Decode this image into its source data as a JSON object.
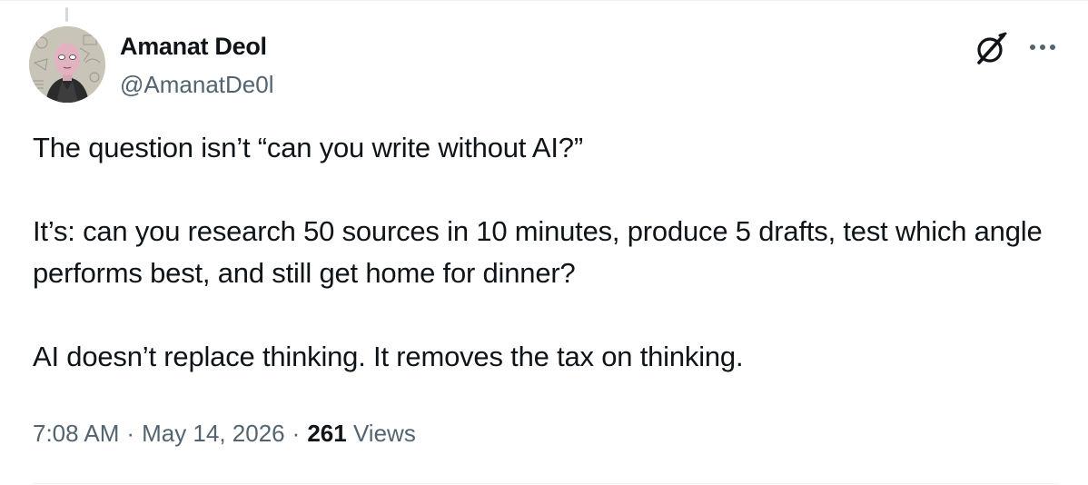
{
  "author": {
    "display_name": "Amanat Deol",
    "handle": "@AmanatDe0l"
  },
  "icons": {
    "avatar": "avatar-illustration",
    "grok": "grok-icon",
    "more": "more-options-icon"
  },
  "tweet": {
    "paragraphs": [
      "The question isn’t “can you write without AI?”",
      "It’s: can you research 50 sources in 10 minutes, produce 5 drafts, test which angle performs best, and still get home for dinner?",
      "AI doesn’t replace thinking. It removes the tax on thinking."
    ]
  },
  "meta": {
    "time": "7:08 AM",
    "separator": "·",
    "date": "May 14, 2026",
    "views_count": "261",
    "views_label": "Views"
  },
  "colors": {
    "text_primary": "#0f1419",
    "text_secondary": "#536471",
    "divider": "#eff3f4"
  }
}
